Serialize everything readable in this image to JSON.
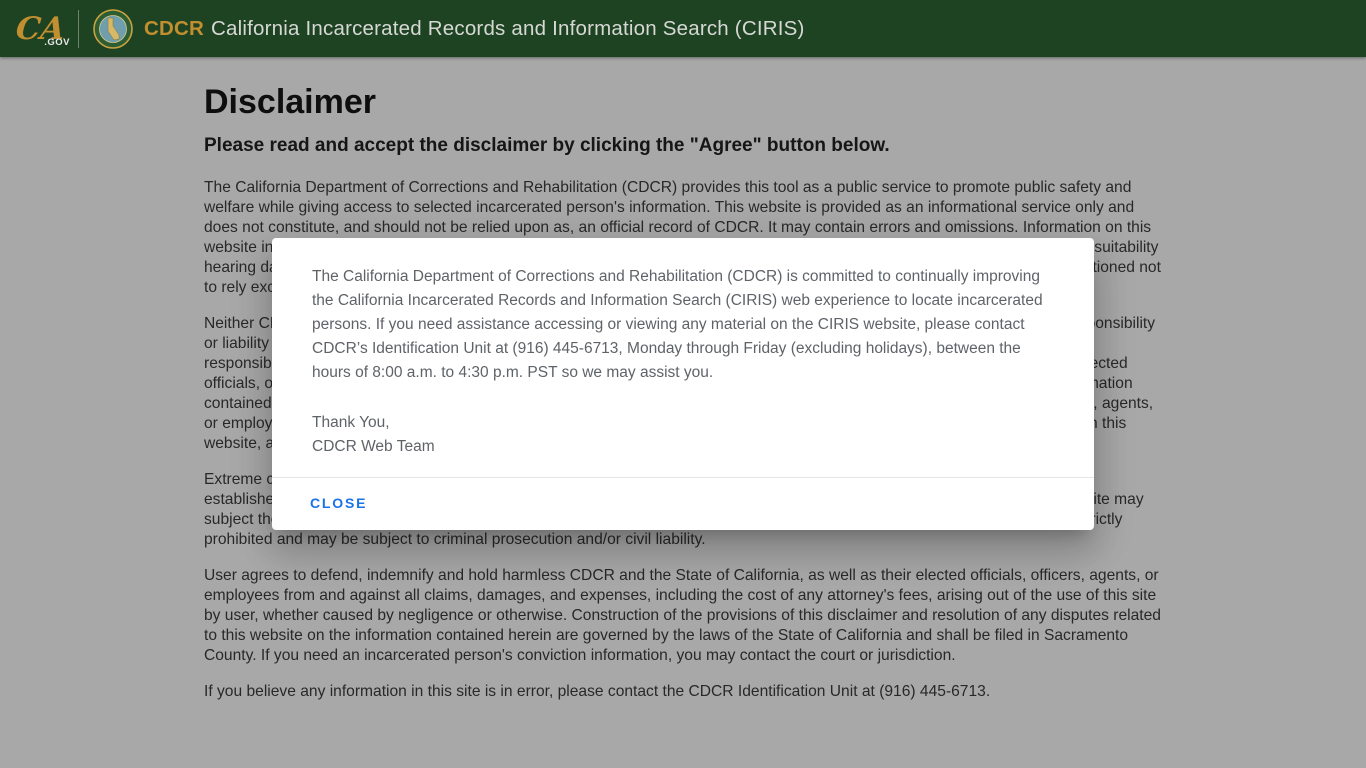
{
  "header": {
    "ca_logo_main": "CA",
    "ca_logo_sub": ".GOV",
    "brand": "CDCR",
    "title": "California Incarcerated Records and Information Search (CIRIS)"
  },
  "page": {
    "title": "Disclaimer",
    "subtitle": "Please read and accept the disclaimer by clicking the \"Agree\" button below.",
    "paragraphs": [
      "The California Department of Corrections and Rehabilitation (CDCR) provides this tool as a public service to promote public safety and welfare while giving access to selected incarcerated person's information. This website is provided as an informational service only and does not constitute, and should not be relied upon as, an official record of CDCR. It may contain errors and omissions. Information on this website includes an incarcerated person's name, age, commitment county, admitted date, current location, and scheduled parole suitability hearing dates. CDCR makes no guarantee, expressed or implied, that the information is accurate or complete, and users are cautioned not to rely exclusively upon the information contained in this website.",
      "Neither CDCR nor any of its officers, agents, or employees makes any warranty, expressed or implied, or assumes any legal responsibility or liability for the accuracy, completeness, or usefulness of any information provided on this website. The user shall assume all responsibility and risk for the use of this website and of the information contained herein. The user, and not CDCR or any of its elected officials, officers, agents, or employees, shall bear all responsibility and costs arising out of the use of, or reliance upon, the information contained in this website. The user agrees to hold harmless CDCR, the State of California, and any of its elected officials, officers, agents, or employees from any and all claims, demands, or actions arising out of the use of, or reliance upon, the information contained in this website, and waives any and all rights to compensation for damages related to the information contained in this website.",
      "Extreme caution should be exercised when attempting to identify an individual using this website; positive identification cannot be established by relying solely upon name, age, or other general identifiers. Unauthorized use of any of the information in this website may subject the user to criminal prosecution and/or civil liability.Unauthorized attempts to change the information in this website are strictly prohibited and may be subject to criminal prosecution and/or civil liability.",
      "User agrees to defend, indemnify and hold harmless CDCR and the State of California, as well as their elected officials, officers, agents, or employees from and against all claims, damages, and expenses, including the cost of any attorney's fees, arising out of the use of this site by user, whether caused by negligence or otherwise. Construction of the provisions of this disclaimer and resolution of any disputes related to this website on the information contained herein are governed by the laws of the State of California and shall be filed in Sacramento County. If you need an incarcerated person's conviction information, you may contact the court or jurisdiction.",
      "If you believe any information in this site is in error, please contact the CDCR Identification Unit at (916) 445-6713."
    ]
  },
  "modal": {
    "message": "The California Department of Corrections and Rehabilitation (CDCR) is committed to continually improving the California Incarcerated Records and Information Search (CIRIS) web experience to locate incarcerated persons. If you need assistance accessing or viewing any material on the CIRIS website, please contact CDCR’s Identification Unit at (916) 445-6713, Monday through Friday (excluding holidays), between the hours of 8:00 a.m. to 4:30 p.m. PST so we may assist you.",
    "signoff_line1": "Thank You,",
    "signoff_line2": "CDCR Web Team",
    "close_label": "CLOSE"
  },
  "icons": {
    "ca_gov_logo": "ca-gov-script-logo",
    "cdcr_seal": "cdcr-circular-seal"
  },
  "colors": {
    "header-bg": "#1e4323",
    "brand-gold": "#c18f2f",
    "header-text": "#d6d8d4",
    "text": "#3d3d3d",
    "close-blue": "#1a73e8",
    "modal-text": "#5f6368",
    "divider": "#e5e5e5"
  }
}
